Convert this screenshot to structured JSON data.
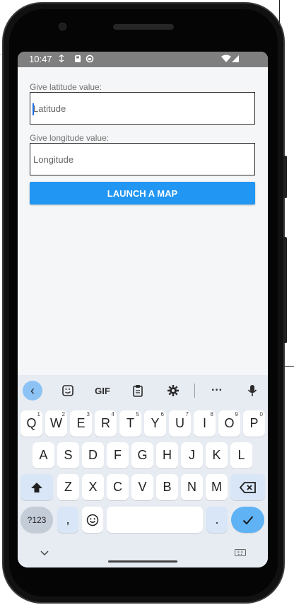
{
  "status_bar": {
    "time": "10:47"
  },
  "app": {
    "latitude_label": "Give latitude value:",
    "latitude_placeholder": "Latitude",
    "longitude_label": "Give longitude value:",
    "longitude_placeholder": "Longitude",
    "launch_button": "LAUNCH A MAP"
  },
  "keyboard": {
    "toolbar": {
      "gif_label": "GIF",
      "more_label": "···"
    },
    "row1": [
      {
        "key": "Q",
        "hint": "1"
      },
      {
        "key": "W",
        "hint": "2"
      },
      {
        "key": "E",
        "hint": "3"
      },
      {
        "key": "R",
        "hint": "4"
      },
      {
        "key": "T",
        "hint": "5"
      },
      {
        "key": "Y",
        "hint": "6"
      },
      {
        "key": "U",
        "hint": "7"
      },
      {
        "key": "I",
        "hint": "8"
      },
      {
        "key": "O",
        "hint": "9"
      },
      {
        "key": "P",
        "hint": "0"
      }
    ],
    "row2": [
      "A",
      "S",
      "D",
      "F",
      "G",
      "H",
      "J",
      "K",
      "L"
    ],
    "row3": [
      "Z",
      "X",
      "C",
      "V",
      "B",
      "N",
      "M"
    ],
    "bottom": {
      "symbols": "?123",
      "comma": ",",
      "period": "."
    }
  },
  "colors": {
    "accent": "#2196f3",
    "status_bar": "#7f7f7f",
    "keyboard_bg": "#e7ebf2",
    "enter_key": "#5fb3f5"
  },
  "icons": {
    "status": [
      "sync-icon",
      "sd-card-icon",
      "data-saver-icon",
      "wifi-icon",
      "signal-icon"
    ],
    "toolbar": [
      "back-chevron-icon",
      "sticker-icon",
      "clipboard-icon",
      "gear-icon",
      "microphone-icon"
    ]
  }
}
